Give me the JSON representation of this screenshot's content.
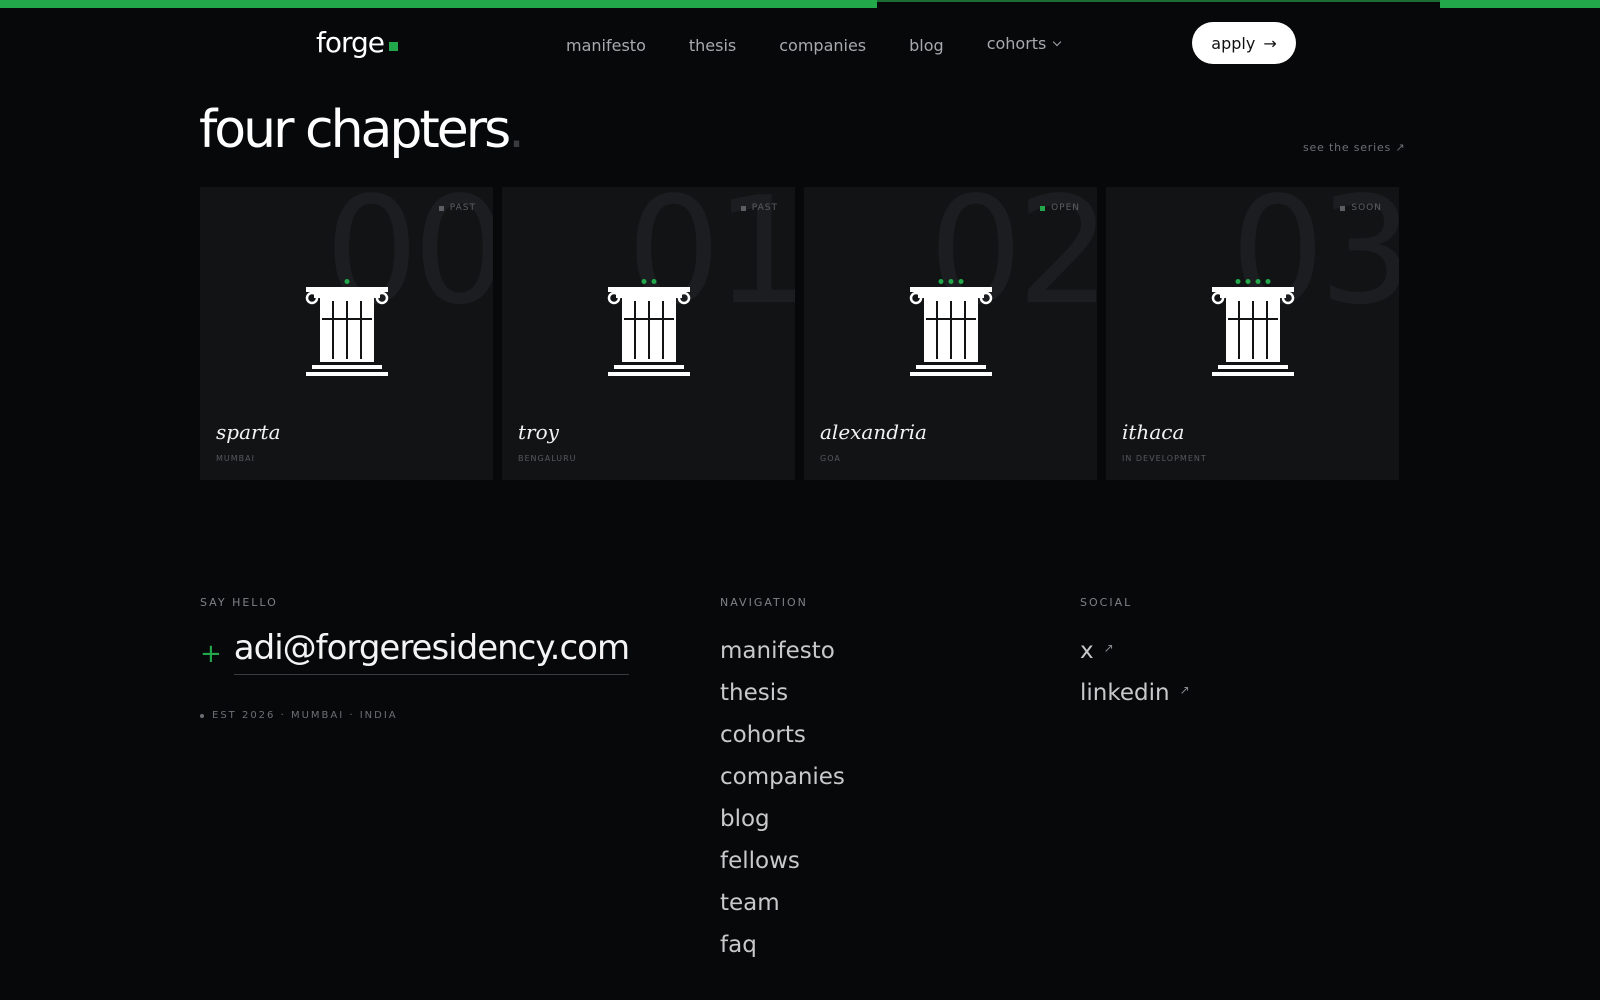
{
  "header": {
    "logo": "forge",
    "nav": [
      {
        "label": "manifesto"
      },
      {
        "label": "thesis"
      },
      {
        "label": "companies"
      },
      {
        "label": "blog"
      },
      {
        "label": "cohorts"
      }
    ],
    "apply_label": "apply",
    "apply_arrow": "→"
  },
  "chapters": {
    "title": "four chapters",
    "title_dot": ".",
    "see_series": "see the series ↗",
    "cards": [
      {
        "number": "00",
        "status": "PAST",
        "name": "sparta",
        "location": "MUMBAI",
        "dots": 1,
        "open": false
      },
      {
        "number": "01",
        "status": "PAST",
        "name": "troy",
        "location": "BENGALURU",
        "dots": 2,
        "open": false
      },
      {
        "number": "02",
        "status": "OPEN",
        "name": "alexandria",
        "location": "GOA",
        "dots": 3,
        "open": true
      },
      {
        "number": "03",
        "status": "SOON",
        "name": "ithaca",
        "location": "IN DEVELOPMENT",
        "dots": 4,
        "open": false
      }
    ]
  },
  "footer": {
    "say_hello_label": "SAY HELLO",
    "plus": "+",
    "email": "adi@forgeresidency.com",
    "est": "EST 2026 · MUMBAI · INDIA",
    "navigation_label": "NAVIGATION",
    "nav_links": [
      {
        "label": "manifesto"
      },
      {
        "label": "thesis"
      },
      {
        "label": "cohorts"
      },
      {
        "label": "companies"
      },
      {
        "label": "blog"
      },
      {
        "label": "fellows"
      },
      {
        "label": "team"
      },
      {
        "label": "faq"
      }
    ],
    "social_label": "SOCIAL",
    "social_links": [
      {
        "label": "x"
      },
      {
        "label": "linkedin"
      }
    ],
    "ext_arrow": "↗"
  },
  "colors": {
    "accent": "#22a84a",
    "background": "#07080a",
    "card": "#121315"
  }
}
